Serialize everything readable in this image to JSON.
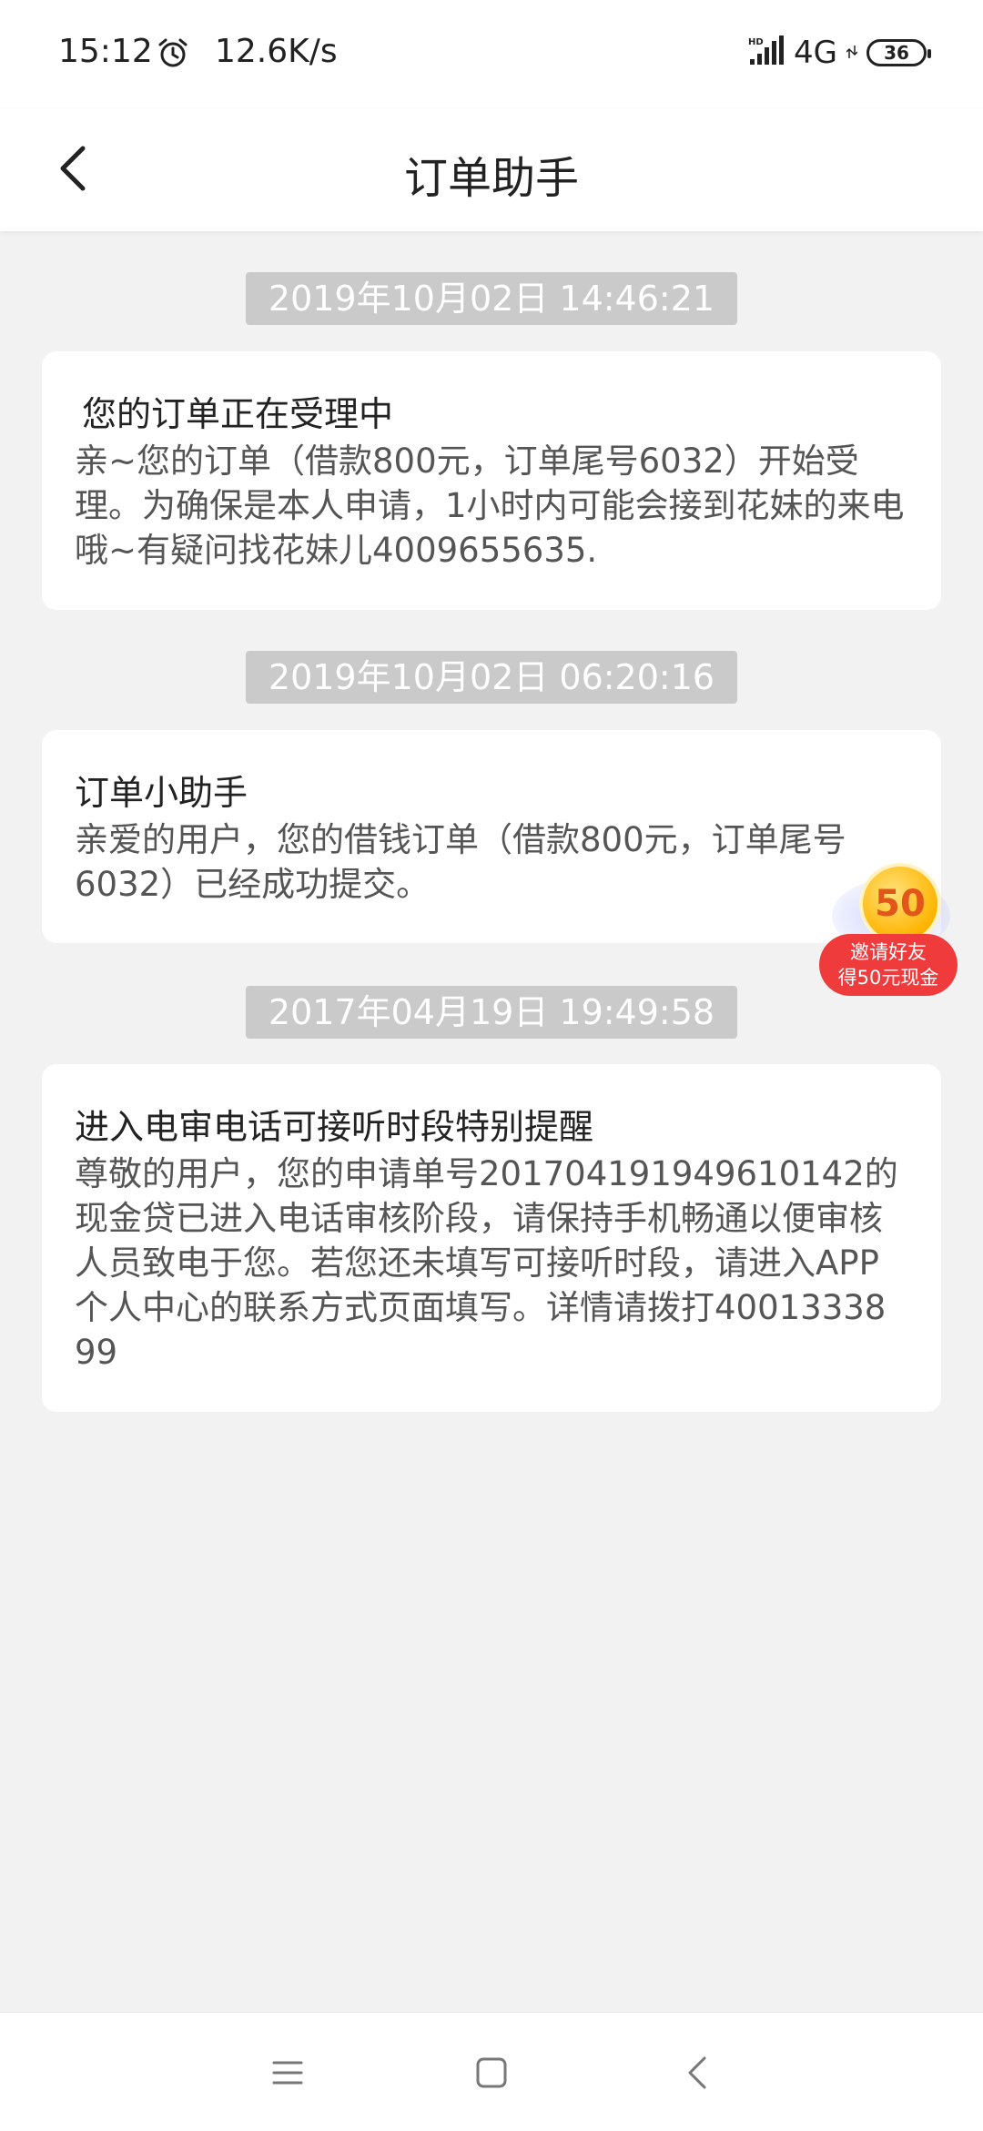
{
  "status_bar": {
    "time": "15:12",
    "speed": "12.6K/s",
    "network": "4G",
    "battery": "36"
  },
  "header": {
    "title": "订单助手"
  },
  "messages": [
    {
      "timestamp": "2019年10月02日 14:46:21",
      "title": "您的订单正在受理中",
      "body": "亲~您的订单（借款800元，订单尾号6032）开始受理。为确保是本人申请，1小时内可能会接到花妹的来电哦~有疑问找花妹儿4009655635."
    },
    {
      "timestamp": "2019年10月02日 06:20:16",
      "title": "订单小助手",
      "body": "亲爱的用户，您的借钱订单（借款800元，订单尾号6032）已经成功提交。"
    },
    {
      "timestamp": "2017年04月19日 19:49:58",
      "title": "进入电审电话可接听时段特别提醒",
      "body": "尊敬的用户，您的申请单号20170419194961014​2的现金贷已进入电话审核阶段，请保持手机畅通以便审核人员致电于您。若您还未填写可接听时段，请进入APP个人中心的联系方式页面填写。详情请拨打4001333899"
    }
  ],
  "invite_badge": {
    "amount": "50",
    "line1": "邀请好友",
    "line2": "得50元现金"
  },
  "colors": {
    "timestamp_bg": "#cacaca",
    "badge_red": "#ef3b3b",
    "page_bg": "#f2f2f3"
  }
}
